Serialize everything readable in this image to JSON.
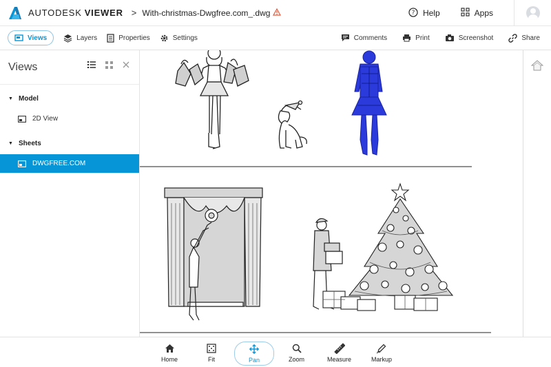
{
  "header": {
    "brand_prefix": "AUTODESK",
    "brand_suffix": "VIEWER",
    "breadcrumb_separator": ">",
    "filename": "With-christmas-Dwgfree.com_.dwg",
    "help_label": "Help",
    "apps_label": "Apps"
  },
  "toolbar": {
    "views_label": "Views",
    "layers_label": "Layers",
    "properties_label": "Properties",
    "settings_label": "Settings",
    "comments_label": "Comments",
    "print_label": "Print",
    "screenshot_label": "Screenshot",
    "share_label": "Share"
  },
  "panel": {
    "title": "Views",
    "groups": [
      {
        "label": "Model",
        "items": [
          {
            "label": "2D View"
          }
        ]
      },
      {
        "label": "Sheets",
        "items": [
          {
            "label": "DWGFREE.COM",
            "selected": true
          }
        ]
      }
    ]
  },
  "bottombar": {
    "home_label": "Home",
    "fit_label": "Fit",
    "pan_label": "Pan",
    "zoom_label": "Zoom",
    "measure_label": "Measure",
    "markup_label": "Markup"
  },
  "colors": {
    "accent": "#0696d7",
    "selection_highlight": "#2b3bdb",
    "drawing_fill": "#d6d6d6",
    "warning": "#e35a3c"
  }
}
